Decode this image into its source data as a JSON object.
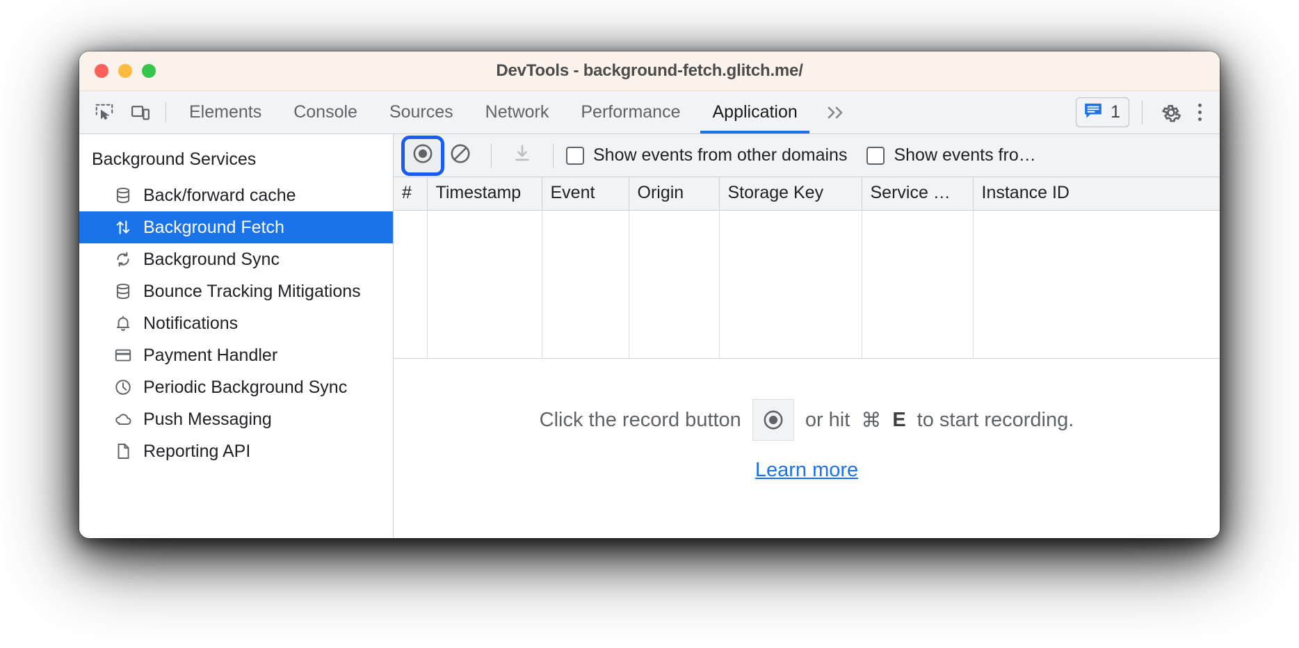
{
  "window": {
    "title": "DevTools - background-fetch.glitch.me/",
    "traffic_lights": [
      "close",
      "minimize",
      "maximize"
    ],
    "colors": {
      "titlebar_bg": "#fcf2ec",
      "accent": "#1a73e8",
      "focus_ring": "#1a5cf0",
      "toolbar_bg": "#f1f3f4"
    }
  },
  "tabbar": {
    "left_icons": [
      {
        "name": "inspect-element-icon",
        "label": "Inspect element"
      },
      {
        "name": "device-toolbar-icon",
        "label": "Toggle device toolbar"
      }
    ],
    "tabs": [
      {
        "label": "Elements",
        "active": false
      },
      {
        "label": "Console",
        "active": false
      },
      {
        "label": "Sources",
        "active": false
      },
      {
        "label": "Network",
        "active": false
      },
      {
        "label": "Performance",
        "active": false
      },
      {
        "label": "Application",
        "active": true
      }
    ],
    "more_tabs_label": "»",
    "messages": {
      "icon": "message-icon",
      "count": "1"
    },
    "settings_icon": "gear-icon",
    "kebab_icon": "more-options-icon"
  },
  "sidebar": {
    "title": "Background Services",
    "items": [
      {
        "label": "Back/forward cache",
        "icon": "database-icon",
        "selected": false
      },
      {
        "label": "Background Fetch",
        "icon": "arrows-up-down-icon",
        "selected": true
      },
      {
        "label": "Background Sync",
        "icon": "sync-icon",
        "selected": false
      },
      {
        "label": "Bounce Tracking Mitigations",
        "icon": "database-icon",
        "selected": false
      },
      {
        "label": "Notifications",
        "icon": "bell-icon",
        "selected": false
      },
      {
        "label": "Payment Handler",
        "icon": "credit-card-icon",
        "selected": false
      },
      {
        "label": "Periodic Background Sync",
        "icon": "clock-icon",
        "selected": false
      },
      {
        "label": "Push Messaging",
        "icon": "cloud-icon",
        "selected": false
      },
      {
        "label": "Reporting API",
        "icon": "document-icon",
        "selected": false
      }
    ]
  },
  "panel_toolbar": {
    "record_button": {
      "icon": "record-icon",
      "label": "Start recording events",
      "focused": true
    },
    "clear_button": {
      "icon": "clear-icon",
      "label": "Clear"
    },
    "export_button": {
      "icon": "download-icon",
      "label": "Save events",
      "disabled": true
    },
    "checkboxes": [
      {
        "label": "Show events from other domains",
        "checked": false
      },
      {
        "label": "Show events fro…",
        "checked": false
      }
    ]
  },
  "table": {
    "columns": [
      "#",
      "Timestamp",
      "Event",
      "Origin",
      "Storage Key",
      "Service …",
      "Instance ID"
    ],
    "rows": []
  },
  "empty_state": {
    "text_before": "Click the record button",
    "record_icon": "record-icon",
    "text_after_prefix": "or hit",
    "shortcut_modifier": "⌘",
    "shortcut_key": "E",
    "text_after_suffix": "to start recording.",
    "link": "Learn more"
  }
}
